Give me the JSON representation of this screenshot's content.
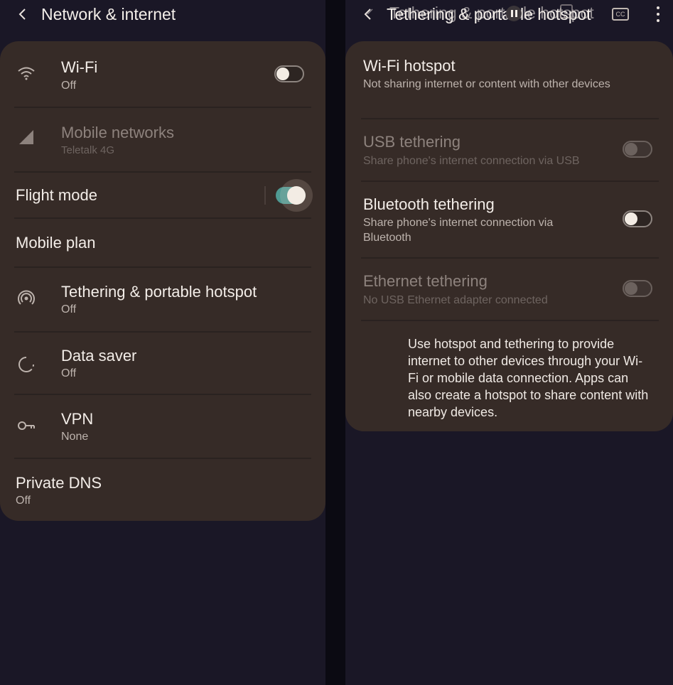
{
  "left": {
    "header": {
      "title": "Network & internet"
    },
    "rows": {
      "wifi": {
        "title": "Wi-Fi",
        "sub": "Off"
      },
      "mobile": {
        "title": "Mobile networks",
        "sub": "Teletalk 4G"
      },
      "flight": {
        "title": "Flight mode"
      },
      "plan": {
        "title": "Mobile plan"
      },
      "tethering": {
        "title": "Tethering & portable hotspot",
        "sub": "Off"
      },
      "datasaver": {
        "title": "Data saver",
        "sub": "Off"
      },
      "vpn": {
        "title": "VPN",
        "sub": "None"
      },
      "dns": {
        "title": "Private DNS",
        "sub": "Off"
      }
    }
  },
  "right": {
    "header": {
      "title": "Tethering & portable hotspot",
      "ghost_title": "Tethering & portable hotspot"
    },
    "rows": {
      "hotspot": {
        "title": "Wi-Fi hotspot",
        "sub": "Not sharing internet or content with other devices"
      },
      "usb": {
        "title": "USB tethering",
        "sub": "Share phone's internet connection via USB"
      },
      "bluetooth": {
        "title": "Bluetooth tethering",
        "sub1": "Share phone's internet connection via",
        "sub2": "Bluetooth"
      },
      "ethernet": {
        "title": "Ethernet tethering",
        "sub": "No USB Ethernet adapter connected"
      }
    },
    "info": "Use hotspot and tethering to provide internet to other devices through your Wi-Fi or mobile data connection. Apps can also create a hotspot to share content with nearby devices.",
    "cc_label": "CC"
  },
  "colors": {
    "background": "#1a1726",
    "card": "#362b27",
    "accent_on": "#4f9a93"
  },
  "icons": {
    "wifi": "wifi-icon",
    "mobile": "signal-icon",
    "tethering": "hotspot-icon",
    "datasaver": "data-saver-icon",
    "vpn": "key-icon",
    "back": "back-arrow-icon",
    "pause": "pause-icon",
    "cc": "closed-captions-icon",
    "more": "more-vert-icon"
  },
  "toggles": {
    "wifi": false,
    "flight": true,
    "usb": false,
    "bluetooth": false,
    "ethernet": false
  }
}
